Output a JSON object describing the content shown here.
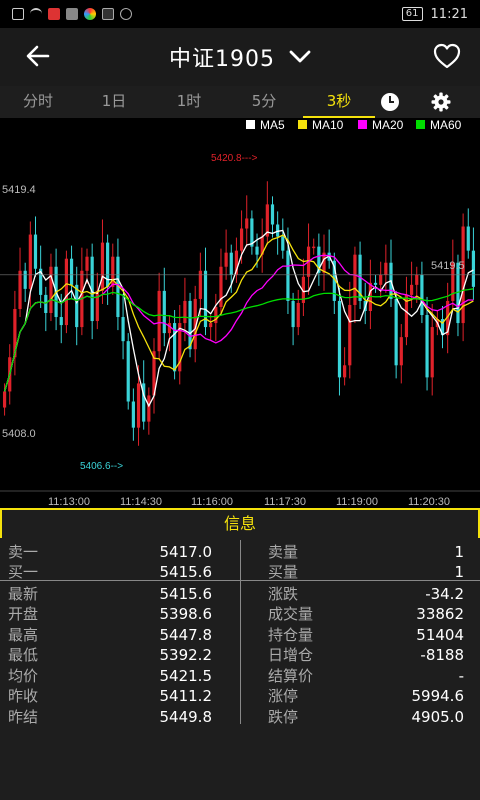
{
  "status_bar": {
    "time": "11:21",
    "battery": "61"
  },
  "header": {
    "title": "中证1905",
    "back_icon": "arrow-left-icon",
    "dropdown_icon": "chevron-down-icon",
    "favorite_icon": "heart-icon"
  },
  "tabs": [
    {
      "label": "分时",
      "active": false
    },
    {
      "label": "1日",
      "active": false
    },
    {
      "label": "1时",
      "active": false
    },
    {
      "label": "5分",
      "active": false
    },
    {
      "label": "3秒",
      "active": true
    }
  ],
  "tab_icons": [
    "clock-icon",
    "gear-icon"
  ],
  "chart_data": {
    "type": "candlestick",
    "y_axis_labels": [
      "5419.4",
      "5408.0"
    ],
    "price_marks": {
      "high": "5420.8--->",
      "low": "5406.6-->",
      "right": "5419.5"
    },
    "x_ticks": [
      "11:13:00",
      "11:14:30",
      "11:16:00",
      "11:17:30",
      "11:19:00",
      "11:20:30"
    ],
    "legend": [
      {
        "name": "MA5",
        "color": "#ffffff"
      },
      {
        "name": "MA10",
        "color": "#f5e20c"
      },
      {
        "name": "MA20",
        "color": "#ff00ff"
      },
      {
        "name": "MA60",
        "color": "#00dd00"
      }
    ],
    "ylim": [
      5405.0,
      5422.5
    ],
    "up_color": "#e0222a",
    "down_color": "#3ad3d8",
    "reference_price": 5415.6,
    "closes": [
      5409.8,
      5411.5,
      5413.9,
      5415.8,
      5414.9,
      5417.6,
      5415.9,
      5414.6,
      5413.7,
      5416.0,
      5413.5,
      5413.1,
      5416.4,
      5415.1,
      5413.0,
      5415.8,
      5416.5,
      5413.3,
      5414.8,
      5417.2,
      5415.0,
      5416.5,
      5413.5,
      5412.3,
      5409.3,
      5408.0,
      5410.2,
      5408.3,
      5409.6,
      5411.8,
      5414.8,
      5412.7,
      5413.2,
      5410.8,
      5413.2,
      5414.3,
      5411.9,
      5414.4,
      5415.8,
      5413.0,
      5413.2,
      5414.0,
      5416.0,
      5416.7,
      5415.6,
      5416.8,
      5417.9,
      5418.4,
      5417.0,
      5416.6,
      5417.5,
      5419.1,
      5418.1,
      5417.5,
      5416.8,
      5414.3,
      5413.0,
      5414.2,
      5415.5,
      5417.0,
      5417.0,
      5415.7,
      5416.7,
      5416.3,
      5414.3,
      5410.5,
      5411.1,
      5414.1,
      5416.6,
      5414.3,
      5413.8,
      5415.2,
      5415.1,
      5415.6,
      5416.2,
      5414.4,
      5411.1,
      5412.5,
      5414.6,
      5415.1,
      5415.6,
      5413.6,
      5410.5,
      5413.0,
      5413.4,
      5412.6,
      5414.3,
      5416.2,
      5413.2,
      5418.0,
      5416.8,
      5415.0
    ]
  },
  "info": {
    "title": "信息",
    "left": [
      {
        "label": "卖一",
        "value": "5417.0"
      },
      {
        "label": "买一",
        "value": "5415.6"
      },
      {
        "label": "最新",
        "value": "5415.6"
      },
      {
        "label": "开盘",
        "value": "5398.6"
      },
      {
        "label": "最高",
        "value": "5447.8"
      },
      {
        "label": "最低",
        "value": "5392.2"
      },
      {
        "label": "均价",
        "value": "5421.5"
      },
      {
        "label": "昨收",
        "value": "5411.2"
      },
      {
        "label": "昨结",
        "value": "5449.8"
      }
    ],
    "right": [
      {
        "label": "卖量",
        "value": "1"
      },
      {
        "label": "买量",
        "value": "1"
      },
      {
        "label": "涨跌",
        "value": "-34.2"
      },
      {
        "label": "成交量",
        "value": "33862"
      },
      {
        "label": "持仓量",
        "value": "51404"
      },
      {
        "label": "日增仓",
        "value": "-8188"
      },
      {
        "label": "结算价",
        "value": "-"
      },
      {
        "label": "涨停",
        "value": "5994.6"
      },
      {
        "label": "跌停",
        "value": "4905.0"
      }
    ]
  }
}
